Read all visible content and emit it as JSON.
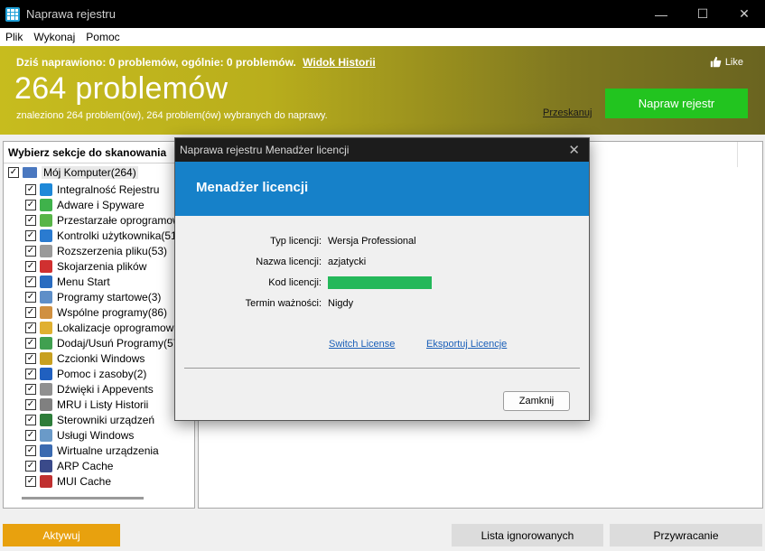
{
  "window": {
    "title": "Naprawa rejestru",
    "minimize": "—",
    "maximize": "☐",
    "close": "✕"
  },
  "menu": [
    "Plik",
    "Wykonaj",
    "Pomoc"
  ],
  "banner": {
    "summary": "Dziś naprawiono: 0 problemów, ogólnie: 0 problemów.",
    "history_link": "Widok Historii",
    "count": "264 problemów",
    "subtitle": "znaleziono 264 problem(ów), 264 problem(ów) wybranych do naprawy.",
    "like": "Like",
    "rescan": "Przeskanuj",
    "fix_button": "Napraw rejestr",
    "fix_color": "#22c41f"
  },
  "left_panel": {
    "header": "Wybierz sekcje do skanowania",
    "root": "Mój Komputer(264)",
    "items": [
      {
        "label": "Integralność Rejestru",
        "icon": "grid-blue-icon",
        "color": "#1e88d8"
      },
      {
        "label": "Adware i Spyware",
        "icon": "shield-icon",
        "color": "#3fb24b"
      },
      {
        "label": "Przestarzałe oprogramowanie",
        "icon": "recycle-bin-icon",
        "color": "#58b548"
      },
      {
        "label": "Kontrolki użytkownika(51)",
        "icon": "blocks-icon",
        "color": "#2a7bd0"
      },
      {
        "label": "Rozszerzenia pliku(53)",
        "icon": "file-ext-icon",
        "color": "#9a9a9a"
      },
      {
        "label": "Skojarzenia plików",
        "icon": "letter-a-icon",
        "color": "#d03030"
      },
      {
        "label": "Menu Start",
        "icon": "start-menu-icon",
        "color": "#2a6cc0"
      },
      {
        "label": "Programy startowe(3)",
        "icon": "startup-window-icon",
        "color": "#5f8fc8"
      },
      {
        "label": "Wspólne programy(86)",
        "icon": "shared-programs-icon",
        "color": "#d09040"
      },
      {
        "label": "Lokalizacje oprogramowania",
        "icon": "folder-icon",
        "color": "#e0b030"
      },
      {
        "label": "Dodaj/Usuń Programy(57)",
        "icon": "add-remove-icon",
        "color": "#40a050"
      },
      {
        "label": "Czcionki Windows",
        "icon": "font-icon",
        "color": "#c8a020"
      },
      {
        "label": "Pomoc i zasoby(2)",
        "icon": "help-icon",
        "color": "#2060c0"
      },
      {
        "label": "Dźwięki i Appevents",
        "icon": "speaker-icon",
        "color": "#909090"
      },
      {
        "label": "MRU i Listy Historii",
        "icon": "clock-icon",
        "color": "#808080"
      },
      {
        "label": "Sterowniki urządzeń",
        "icon": "chip-icon",
        "color": "#2d7d3a"
      },
      {
        "label": "Usługi Windows",
        "icon": "magnifier-icon",
        "color": "#6a9ac8"
      },
      {
        "label": "Wirtualne urządzenia",
        "icon": "virtual-device-icon",
        "color": "#3a6ab0"
      },
      {
        "label": "ARP Cache",
        "icon": "footprint-icon",
        "color": "#3a4a8a"
      },
      {
        "label": "MUI Cache",
        "icon": "mui-cache-icon",
        "color": "#c03030"
      }
    ]
  },
  "bottom": {
    "activate": "Aktywuj",
    "ignored": "Lista ignorowanych",
    "restore": "Przywracanie"
  },
  "dialog": {
    "title": "Naprawa rejestru Menadżer licencji",
    "header": "Menadżer licencji",
    "license_type_label": "Typ licencji:",
    "license_type": "Wersja Professional",
    "license_name_label": "Nazwa licencji:",
    "license_name": "azjatycki",
    "license_code_label": "Kod licencji:",
    "expiry_label": "Termin ważności:",
    "expiry": "Nigdy",
    "switch_license": "Switch License",
    "export_license": "Eksportuj Licencje",
    "close_button": "Zamknij",
    "close_x": "✕"
  }
}
